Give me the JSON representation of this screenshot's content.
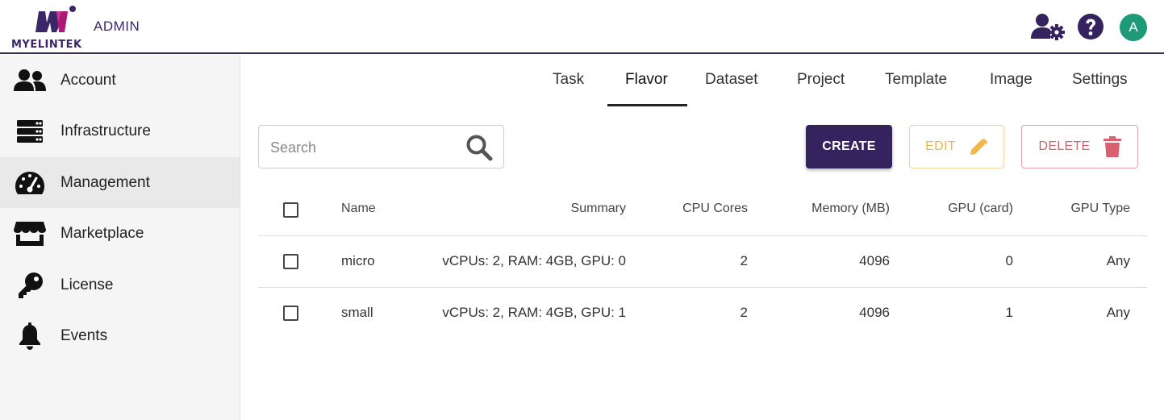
{
  "header": {
    "logo_text": "MyelinTek",
    "role_label": "ADMIN",
    "avatar_letter": "A",
    "icons": [
      "user-gear-icon",
      "help-icon"
    ],
    "colors": {
      "brand": "#3b2667",
      "avatar": "#1f9a79"
    }
  },
  "sidebar": {
    "items": [
      {
        "label": "Account",
        "icon": "users-icon"
      },
      {
        "label": "Infrastructure",
        "icon": "server-icon"
      },
      {
        "label": "Management",
        "icon": "gauge-icon",
        "active": true
      },
      {
        "label": "Marketplace",
        "icon": "store-icon"
      },
      {
        "label": "License",
        "icon": "key-icon"
      },
      {
        "label": "Events",
        "icon": "bell-icon"
      }
    ]
  },
  "tabs": [
    {
      "label": "Task"
    },
    {
      "label": "Flavor",
      "active": true
    },
    {
      "label": "Dataset"
    },
    {
      "label": "Project"
    },
    {
      "label": "Template"
    },
    {
      "label": "Image"
    },
    {
      "label": "Settings"
    }
  ],
  "toolbar": {
    "search_placeholder": "Search",
    "create_label": "CREATE",
    "edit_label": "EDIT",
    "delete_label": "DELETE",
    "colors": {
      "create": "#35235f",
      "edit": "#f0b54b",
      "delete": "#d9606e"
    }
  },
  "table": {
    "columns": [
      "Name",
      "Summary",
      "CPU Cores",
      "Memory (MB)",
      "GPU (card)",
      "GPU Type"
    ],
    "rows": [
      {
        "name": "micro",
        "summary": "vCPUs: 2, RAM: 4GB, GPU: 0",
        "cpu": "2",
        "memory": "4096",
        "gpu": "0",
        "gpu_type": "Any"
      },
      {
        "name": "small",
        "summary": "vCPUs: 2, RAM: 4GB, GPU: 1",
        "cpu": "2",
        "memory": "4096",
        "gpu": "1",
        "gpu_type": "Any"
      }
    ]
  }
}
